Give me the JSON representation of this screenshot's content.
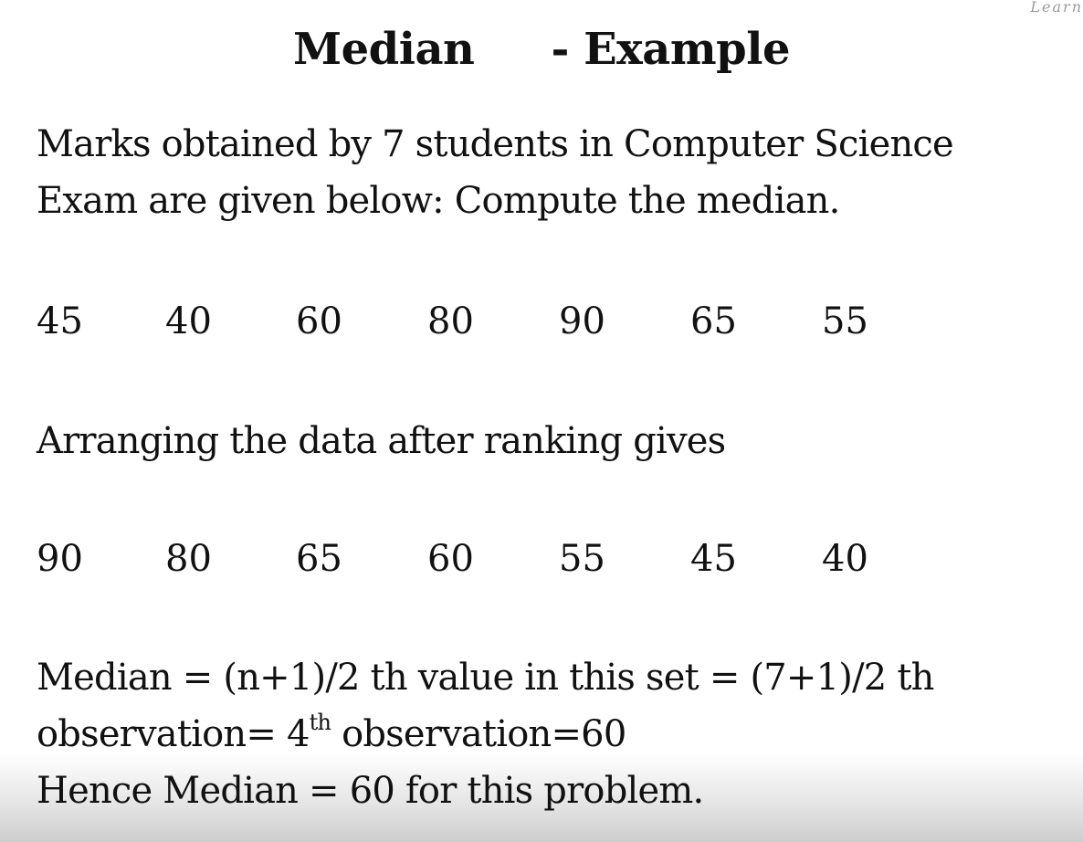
{
  "corner_text": "Learn",
  "title": {
    "left": "Median",
    "right": "- Example"
  },
  "problem": {
    "line1": "Marks obtained by 7 students in Computer Science",
    "line2": "Exam are given below: Compute the median."
  },
  "marks": [
    "45",
    "40",
    "60",
    "80",
    "90",
    "65",
    "55"
  ],
  "arranging_text": "Arranging the data after ranking gives",
  "ranked": [
    "90",
    "80",
    "65",
    "60",
    "55",
    "45",
    "40"
  ],
  "solution": {
    "formula_line": "Median = (n+1)/2 th value in this set = (7+1)/2 th",
    "obs_prefix": "observation= 4",
    "obs_sup": "th",
    "obs_suffix": " observation=60",
    "conclusion": "Hence Median = 60 for this problem."
  }
}
